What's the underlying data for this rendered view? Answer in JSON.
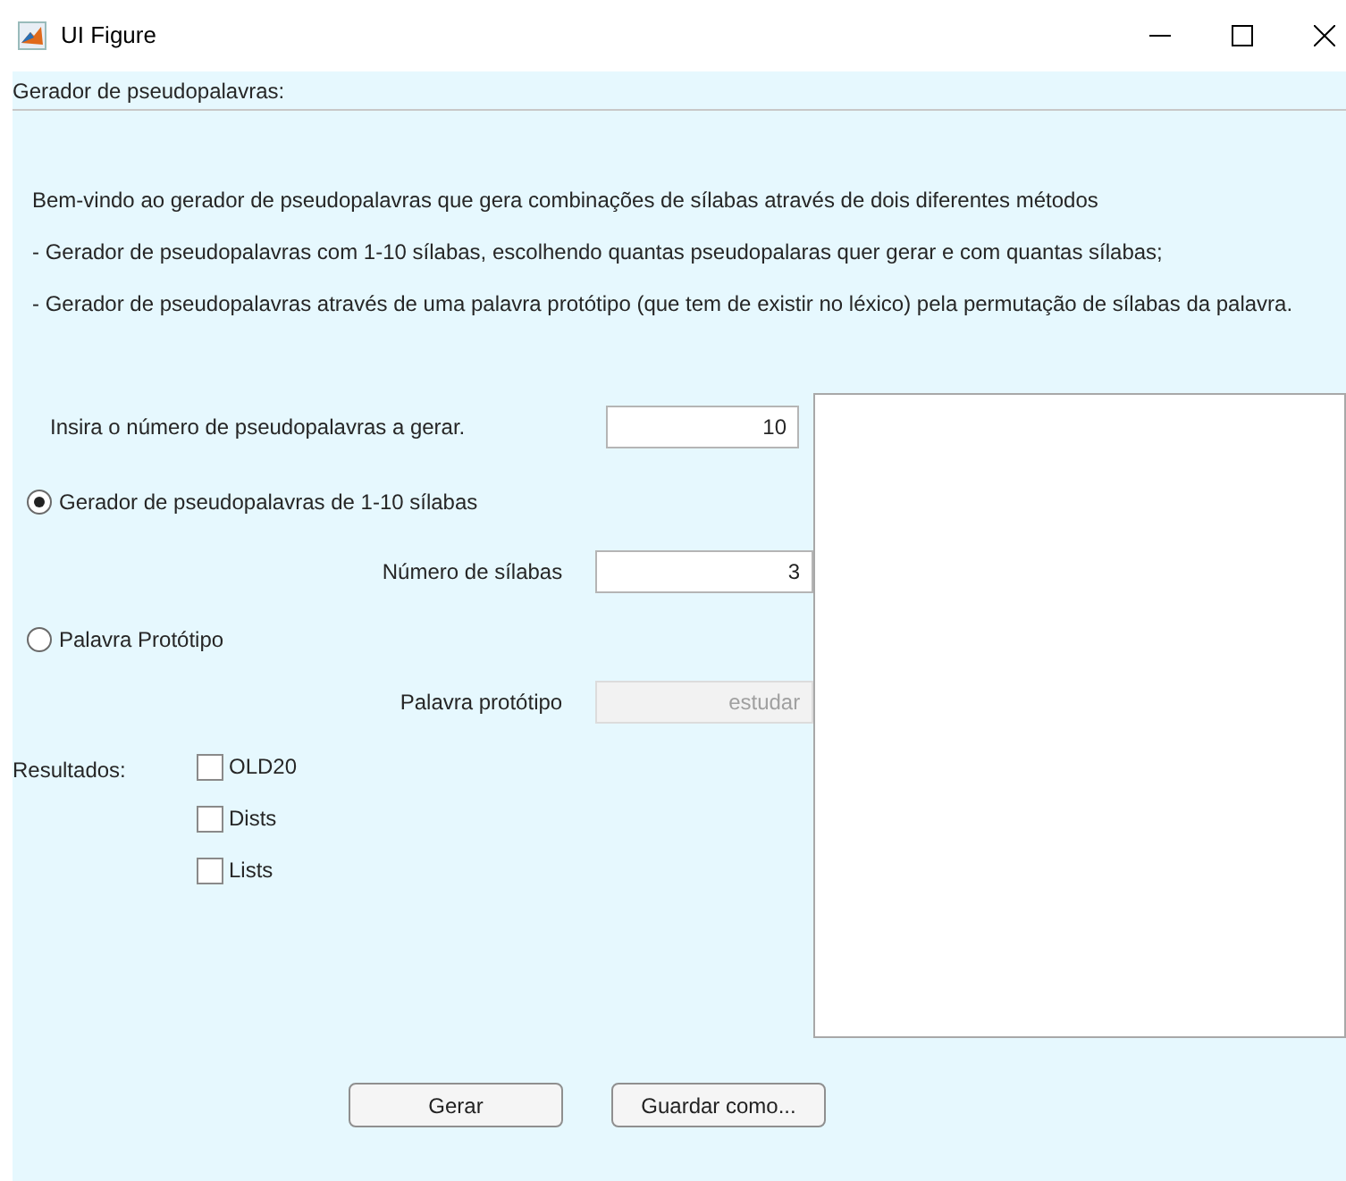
{
  "window": {
    "title": "UI Figure"
  },
  "panel": {
    "title": "Gerador de pseudopalavras:"
  },
  "intro": [
    "Bem-vindo ao gerador de pseudopalavras que gera combinações de sílabas através de dois diferentes métodos",
    "- Gerador de pseudopalavras com 1-10 sílabas, escolhendo quantas pseudopalaras quer gerar e com quantas sílabas;",
    "- Gerador de pseudopalavras através de uma palavra protótipo (que tem de existir no léxico) pela permutação de sílabas da palavra."
  ],
  "count_field": {
    "label": "Insira o número de pseudopalavras a gerar.",
    "value": "10"
  },
  "methods": [
    {
      "label": "Gerador de pseudopalavras de 1-10 sílabas",
      "selected": true,
      "field": {
        "label": "Número de sílabas",
        "value": "3",
        "disabled": false
      }
    },
    {
      "label": "Palavra Protótipo",
      "selected": false,
      "field": {
        "label": "Palavra protótipo",
        "value": "estudar",
        "disabled": true
      }
    }
  ],
  "results": {
    "label": "Resultados:",
    "options": [
      {
        "label": "OLD20",
        "checked": false
      },
      {
        "label": "Dists",
        "checked": false
      },
      {
        "label": "Lists",
        "checked": false
      }
    ]
  },
  "buttons": [
    "Gerar",
    "Guardar como..."
  ]
}
